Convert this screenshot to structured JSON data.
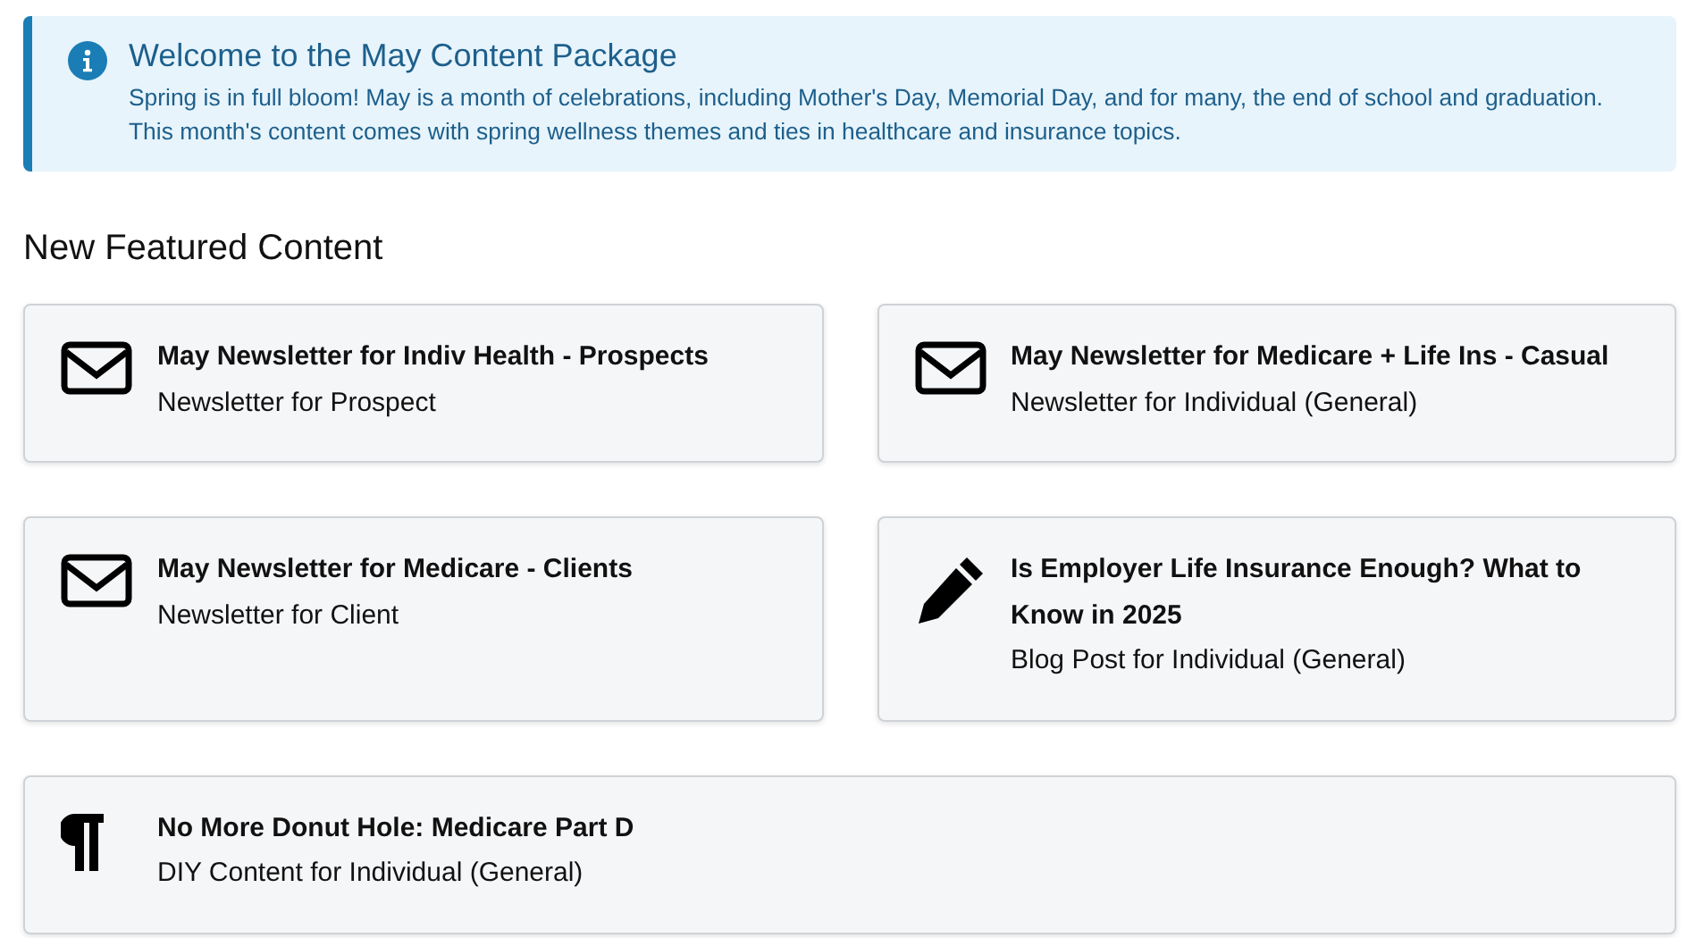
{
  "alert": {
    "title": "Welcome to the May Content Package",
    "text": "Spring is in full bloom! May is a month of celebrations, including Mother's Day, Memorial Day, and for many, the end of school and graduation. This month's content comes with spring wellness themes and ties in healthcare and insurance topics."
  },
  "section_title": "New Featured Content",
  "items": [
    {
      "kind": "newsletter",
      "title": "May Newsletter for Indiv Health - Prospects",
      "subtitle": "Newsletter for Prospect"
    },
    {
      "kind": "newsletter",
      "title": "May Newsletter for Medicare + Life Ins - Casual",
      "subtitle": "Newsletter for Individual (General)"
    },
    {
      "kind": "newsletter",
      "title": "May Newsletter for Medicare - Clients",
      "subtitle": "Newsletter for Client"
    },
    {
      "kind": "blog",
      "title": "Is Employer Life Insurance Enough? What to Know in 2025",
      "subtitle": "Blog Post for Individual (General)"
    },
    {
      "kind": "diy",
      "title": "No More Donut Hole: Medicare Part D",
      "subtitle": "DIY Content for Individual (General)"
    }
  ]
}
